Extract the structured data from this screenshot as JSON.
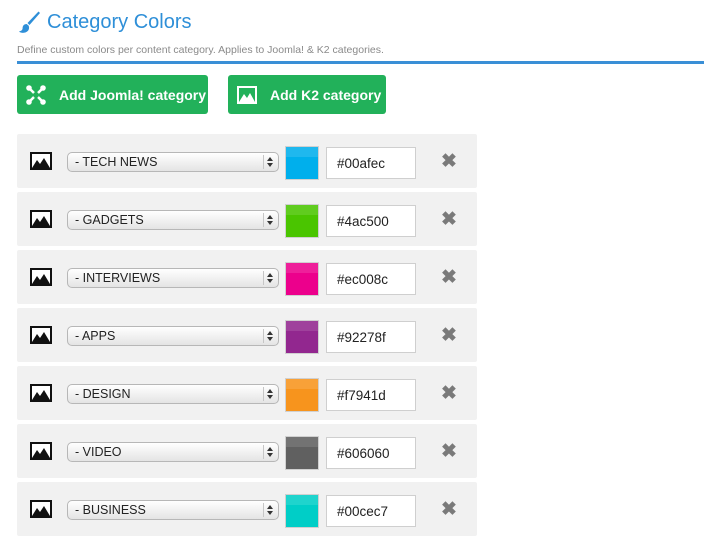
{
  "header": {
    "title": "Category Colors",
    "description": "Define custom colors per content category. Applies to Joomla! & K2 categories.",
    "accent_color": "#2e8fd8"
  },
  "buttons": {
    "add_joomla": "Add Joomla! category",
    "add_k2": "Add K2 category",
    "color": "#22b15a"
  },
  "rows": [
    {
      "category": "- TECH NEWS",
      "hex": "#00afec"
    },
    {
      "category": "- GADGETS",
      "hex": "#4ac500"
    },
    {
      "category": "- INTERVIEWS",
      "hex": "#ec008c"
    },
    {
      "category": "- APPS",
      "hex": "#92278f"
    },
    {
      "category": "- DESIGN",
      "hex": "#f7941d"
    },
    {
      "category": "- VIDEO",
      "hex": "#606060"
    },
    {
      "category": "- BUSINESS",
      "hex": "#00cec7"
    }
  ],
  "icons": {
    "title": "brush-icon",
    "add_joomla": "joomla-logo-icon",
    "add_k2": "image-icon",
    "row": "image-icon",
    "remove": "close-icon",
    "remove_glyph": "✖"
  }
}
